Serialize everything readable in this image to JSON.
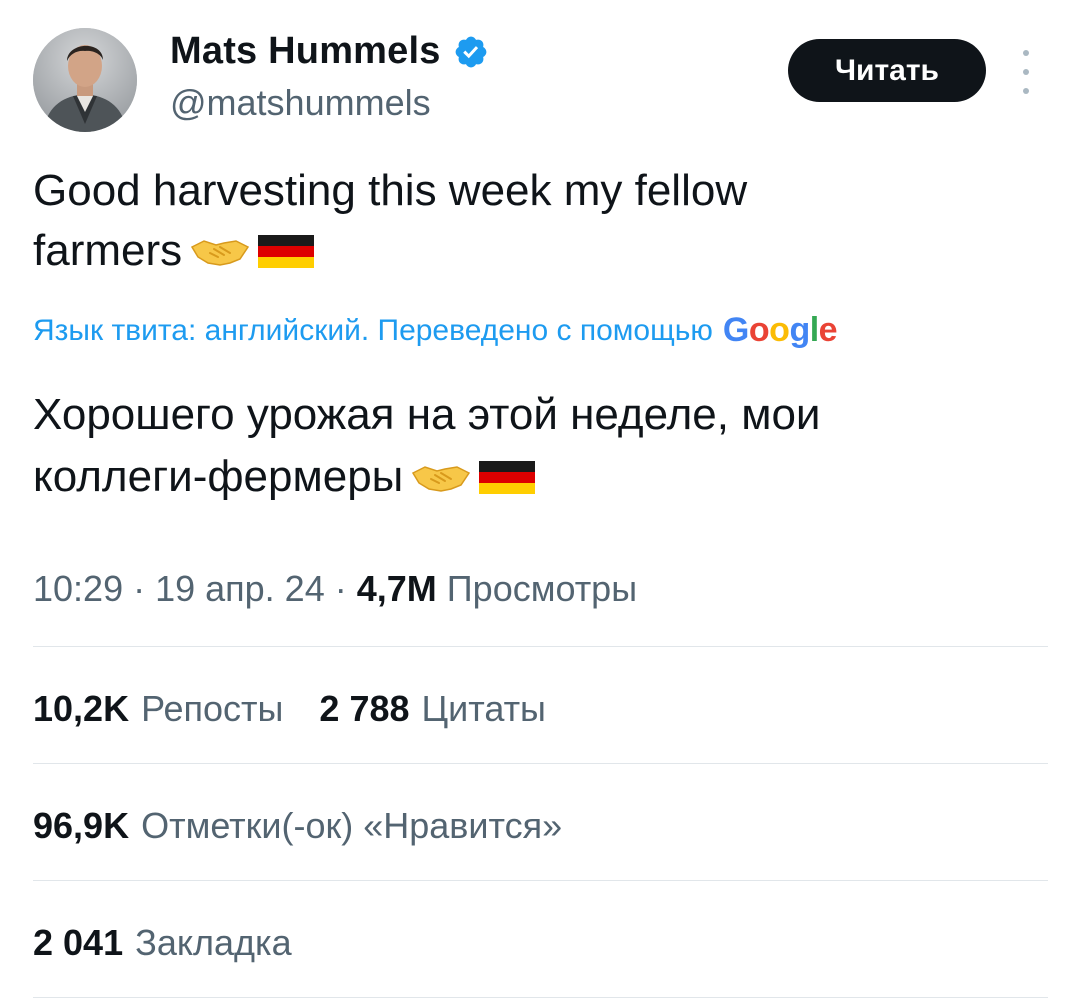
{
  "author": {
    "name": "Mats Hummels",
    "handle": "@matshummels",
    "verified_color": "#1d9bf0"
  },
  "follow_button_label": "Читать",
  "more_icon": "more-vertical-icon",
  "tweet": {
    "text": "Good harvesting this week my fellow\nfarmers",
    "emojis": [
      "handshake",
      "flag-germany"
    ]
  },
  "translation": {
    "note": "Язык твита: английский. Переведено с помощью",
    "provider": [
      "G",
      "o",
      "o",
      "g",
      "l",
      "e"
    ],
    "text": "Хорошего урожая на этой неделе, мои\nколлеги-фермеры"
  },
  "meta": {
    "time": "10:29",
    "date": "19 апр. 24",
    "separator": " · ",
    "views_count": "4,7M",
    "views_label": "Просмотры"
  },
  "stats": {
    "reposts": {
      "value": "10,2K",
      "label": "Репосты"
    },
    "quotes": {
      "value": "2 788",
      "label": "Цитаты"
    },
    "likes": {
      "value": "96,9K",
      "label": "Отметки(-ок) «Нравится»"
    },
    "bookmarks": {
      "value": "2 041",
      "label": "Закладка"
    }
  },
  "colors": {
    "link": "#1d9bf0",
    "secondary_text": "#536471",
    "primary_text": "#0f1419"
  }
}
